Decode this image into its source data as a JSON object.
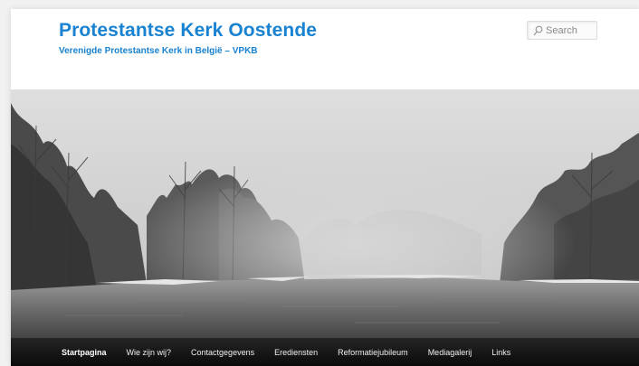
{
  "header": {
    "site_title": "Protestantse Kerk Oostende",
    "site_description": "Verenigde Protestantse Kerk in België – VPKB"
  },
  "search": {
    "placeholder": "Search",
    "icon": "search-icon"
  },
  "header_image": {
    "description_icon": "winter-river-photo"
  },
  "nav": {
    "items": [
      {
        "label": "Startpagina",
        "current": true
      },
      {
        "label": "Wie zijn wij?"
      },
      {
        "label": "Contactgegevens"
      },
      {
        "label": "Erediensten"
      },
      {
        "label": "Reformatiejubileum"
      },
      {
        "label": "Mediagalerij"
      },
      {
        "label": "Links"
      }
    ]
  },
  "colors": {
    "title": "#1982d1",
    "nav_background": "#111111",
    "nav_text": "#eeeeee"
  }
}
